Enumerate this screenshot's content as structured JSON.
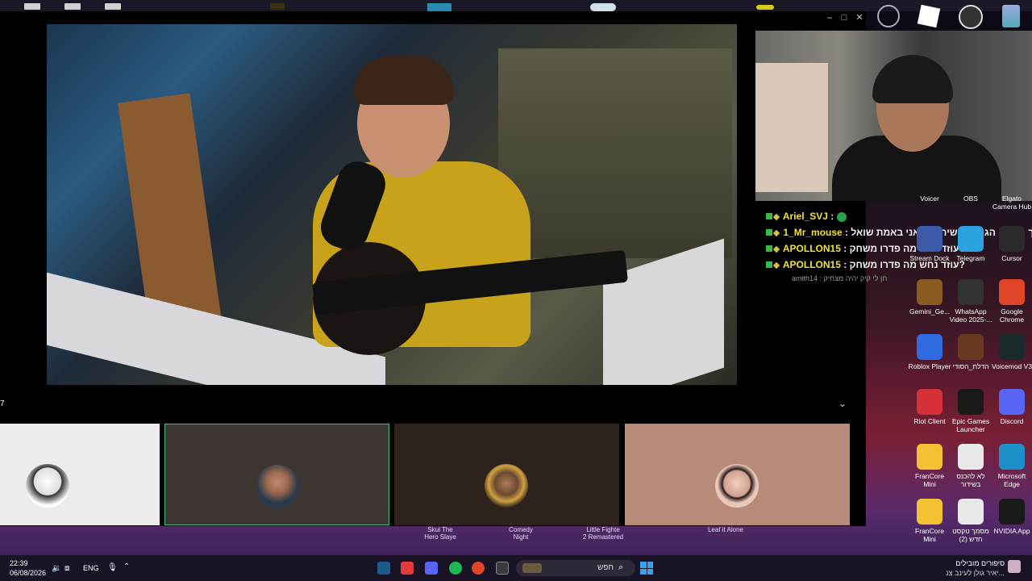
{
  "window": {
    "controls": [
      "–",
      "□",
      "✕"
    ],
    "counter": "7"
  },
  "chat": {
    "messages": [
      {
        "name": "Ariel_SVJ",
        "sep": " :",
        "text": ""
      },
      {
        "name": "1_Mr_mouse",
        "sep": " :",
        "text": " איך מישהו הגנה מהשיר הזה אני באמת שואל"
      },
      {
        "name": "APOLLON15",
        "sep": " :",
        "text": " עוזד נחש מה פדרו משחק?"
      },
      {
        "name": "APOLLON15",
        "sep": " :",
        "text": " עוזד נחש מה פדרו משחק?"
      }
    ],
    "faint": "amith14 : חן לי קיק יהיה מצחיק"
  },
  "tiles": [
    {
      "bg": "#ececec"
    },
    {
      "bg": "#3c3532"
    },
    {
      "bg": "#2e221c"
    },
    {
      "bg": "#b88a7a"
    }
  ],
  "game_labels": [
    "Skul The\nHero Slaye",
    "Comedy\nNight",
    "Little Fighte\n2 Remastered",
    "Leaf it Alone"
  ],
  "desktop": [
    {
      "label": "Voicer",
      "icon": "voicer-icon",
      "color": "#555"
    },
    {
      "label": "OBS",
      "icon": "obs-icon",
      "color": "#333"
    },
    {
      "label": "Elgato\nCamera Hub",
      "icon": "camera-hub-icon",
      "color": "#222"
    },
    {
      "label": "Stream Dock",
      "icon": "stream-dock-icon",
      "color": "#3a5aa8"
    },
    {
      "label": "Telegram",
      "icon": "telegram-icon",
      "color": "#2aa3e0"
    },
    {
      "label": "Cursor",
      "icon": "cursor-icon",
      "color": "#2a2a2a"
    },
    {
      "label": "Gemini_Ge...",
      "icon": "gemini-icon",
      "color": "#8a5a20"
    },
    {
      "label": "WhatsApp\nVideo 2025-...",
      "icon": "video-file-icon",
      "color": "#333"
    },
    {
      "label": "Google\nChrome",
      "icon": "chrome-icon",
      "color": "#e0452a"
    },
    {
      "label": "Roblox Player",
      "icon": "roblox-icon",
      "color": "#2e6ae0"
    },
    {
      "label": "הדלת_הסודי",
      "icon": "image-file-icon",
      "color": "#6a3a20"
    },
    {
      "label": "Voicemod V3",
      "icon": "voicemod-icon",
      "color": "#1a2a2a"
    },
    {
      "label": "Riot Client",
      "icon": "riot-icon",
      "color": "#d6303a"
    },
    {
      "label": "Epic Games\nLauncher",
      "icon": "epic-icon",
      "color": "#1a1a1a"
    },
    {
      "label": "Discord",
      "icon": "discord-icon",
      "color": "#5865f2"
    },
    {
      "label": "FranCore\nMini",
      "icon": "folder-icon",
      "color": "#f2c232"
    },
    {
      "label": "לא להכנס\nבשידור",
      "icon": "doc-icon",
      "color": "#e8e8e8"
    },
    {
      "label": "Microsoft\nEdge",
      "icon": "edge-icon",
      "color": "#1e90c8"
    },
    {
      "label": "FranCore\nMini",
      "icon": "folder-icon",
      "color": "#f2c232"
    },
    {
      "label": "מסמך טקסט\nחדש (2)",
      "icon": "doc-icon",
      "color": "#e8e8e8"
    },
    {
      "label": "NVIDIA App",
      "icon": "nvidia-icon",
      "color": "#1a1a1a"
    }
  ],
  "taskbar": {
    "time": "22:39",
    "date": "06/08/2026",
    "lang": "ENG",
    "search": "חפש",
    "notify_title": "סיפורים מובילים",
    "notify_body": "יאיר גולן לעינב צנ..."
  }
}
